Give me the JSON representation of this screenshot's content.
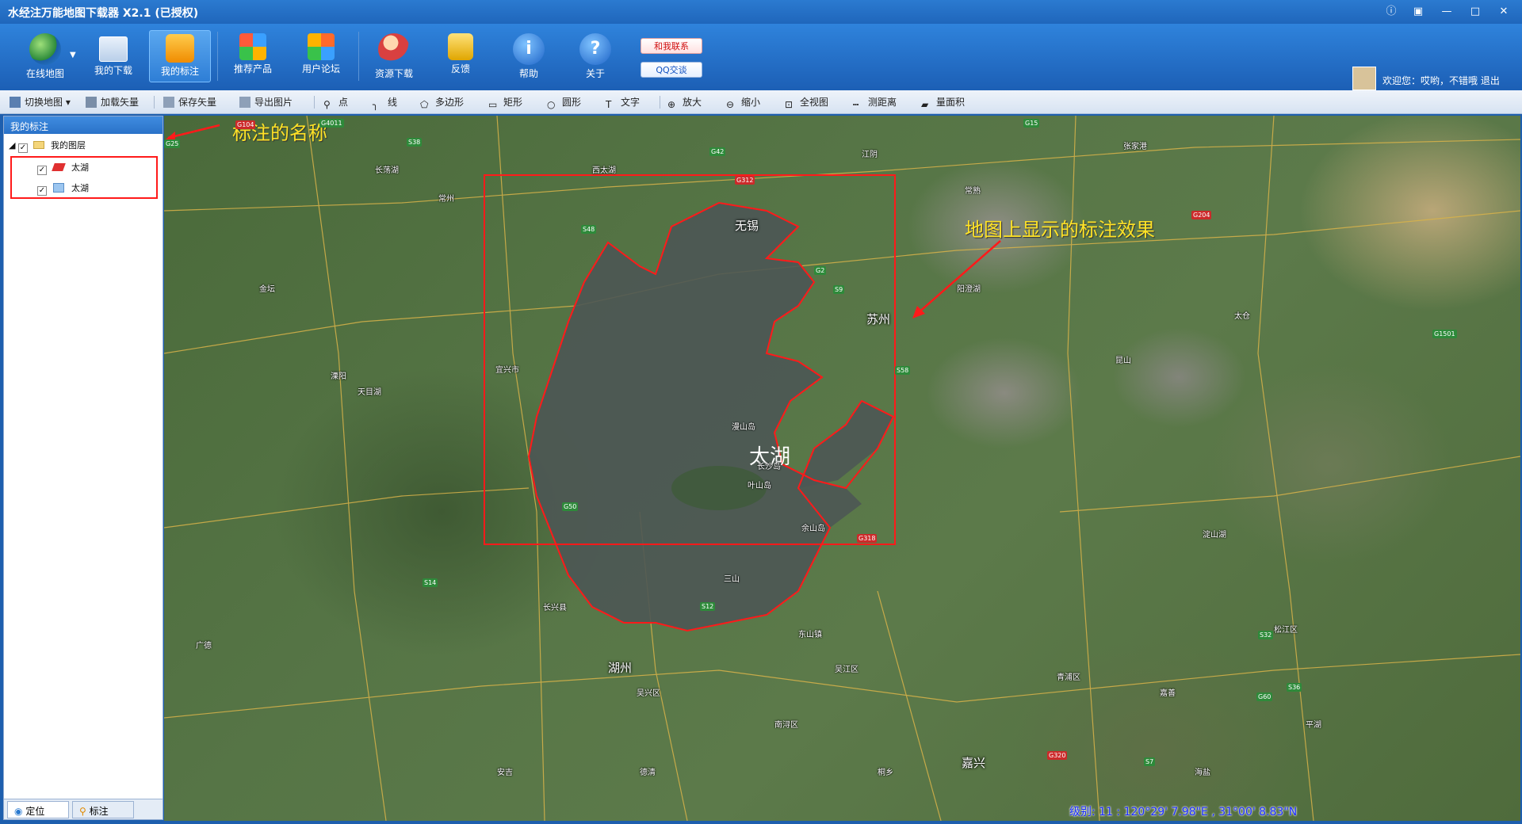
{
  "window": {
    "title": "水经注万能地图下载器 X2.1 (已授权)",
    "controls": [
      "info-icon",
      "settings-icon",
      "minimize-icon",
      "maximize-icon",
      "close-icon"
    ]
  },
  "main_toolbar": {
    "buttons": [
      {
        "label": "在线地图",
        "icon": "globe-icon"
      },
      {
        "label": "我的下载",
        "icon": "download-list-icon"
      },
      {
        "label": "我的标注",
        "icon": "map-pin-icon",
        "active": true
      },
      {
        "label": "推荐产品",
        "icon": "cubes-icon"
      },
      {
        "label": "用户论坛",
        "icon": "forum-icon"
      },
      {
        "label": "资源下载",
        "icon": "people-icon"
      },
      {
        "label": "反馈",
        "icon": "feedback-lock-icon"
      },
      {
        "label": "帮助",
        "icon": "info-icon"
      },
      {
        "label": "关于",
        "icon": "question-icon"
      }
    ],
    "contact_label": "和我联系",
    "qq_label": "QQ交谈",
    "welcome_text": "欢迎您：哎哟，不错哦  退出"
  },
  "function_toolbar": {
    "items": [
      {
        "label": "切换地图",
        "icon": "layers-icon"
      },
      {
        "label": "加载矢量",
        "icon": "load-vector-icon"
      },
      {
        "label": "保存矢量",
        "icon": "save-vector-icon"
      },
      {
        "label": "导出图片",
        "icon": "export-image-icon"
      },
      {
        "label": "点",
        "icon": "point-icon"
      },
      {
        "label": "线",
        "icon": "line-icon"
      },
      {
        "label": "多边形",
        "icon": "polygon-icon"
      },
      {
        "label": "矩形",
        "icon": "rectangle-icon"
      },
      {
        "label": "圆形",
        "icon": "circle-icon"
      },
      {
        "label": "文字",
        "icon": "text-icon"
      },
      {
        "label": "放大",
        "icon": "zoom-in-icon"
      },
      {
        "label": "缩小",
        "icon": "zoom-out-icon"
      },
      {
        "label": "全视图",
        "icon": "full-extent-icon"
      },
      {
        "label": "测距离",
        "icon": "measure-distance-icon"
      },
      {
        "label": "量面积",
        "icon": "measure-area-icon"
      }
    ]
  },
  "left_panel": {
    "title": "我的标注",
    "root_label": "我的图层",
    "layers": [
      {
        "label": "太湖",
        "icon": "polygon-layer-icon",
        "checked": true
      },
      {
        "label": "太湖",
        "icon": "rectangle-layer-icon",
        "checked": true
      }
    ],
    "tabs": [
      {
        "label": "定位",
        "icon": "locate-icon"
      },
      {
        "label": "标注",
        "icon": "pin-icon"
      }
    ]
  },
  "map": {
    "lake_label": "太湖",
    "callout_left": "标注的名称",
    "callout_right": "地图上显示的标注效果",
    "big_cities": [
      "无锡",
      "苏州",
      "湖州",
      "嘉兴"
    ],
    "places": [
      "宜兴市",
      "长兴县",
      "漫山岛",
      "长沙岛",
      "叶山岛",
      "余山岛",
      "三山",
      "东山镇",
      "吴江区",
      "太仓",
      "昆山",
      "常熟",
      "江阴",
      "常州",
      "溧阳",
      "金坛",
      "广德",
      "德清",
      "桐乡",
      "南浔区",
      "吴兴区",
      "安吉",
      "平湖",
      "海盐",
      "嘉善",
      "青浦区",
      "松江区",
      "张家港",
      "阳澄湖",
      "淀山湖",
      "长荡湖",
      "西太湖",
      "天目湖"
    ],
    "road_badges": [
      "G104",
      "G4011",
      "G25",
      "S38",
      "S48",
      "G312",
      "G42",
      "G2",
      "S9",
      "S58",
      "G318",
      "G50",
      "S12",
      "S14",
      "G15",
      "G1501",
      "G60",
      "G320",
      "S7",
      "S32",
      "S36",
      "G204"
    ],
    "status_text": "级别: 11 : 120°29' 7.98\"E , 31°00' 8.83\"N",
    "colors": {
      "annotation_red": "#ff1a1a",
      "callout_yellow": "#ffe326",
      "status_blue": "#1a2cff",
      "road_red": "#cc2a2a",
      "road_green": "#2e8a3a"
    }
  }
}
